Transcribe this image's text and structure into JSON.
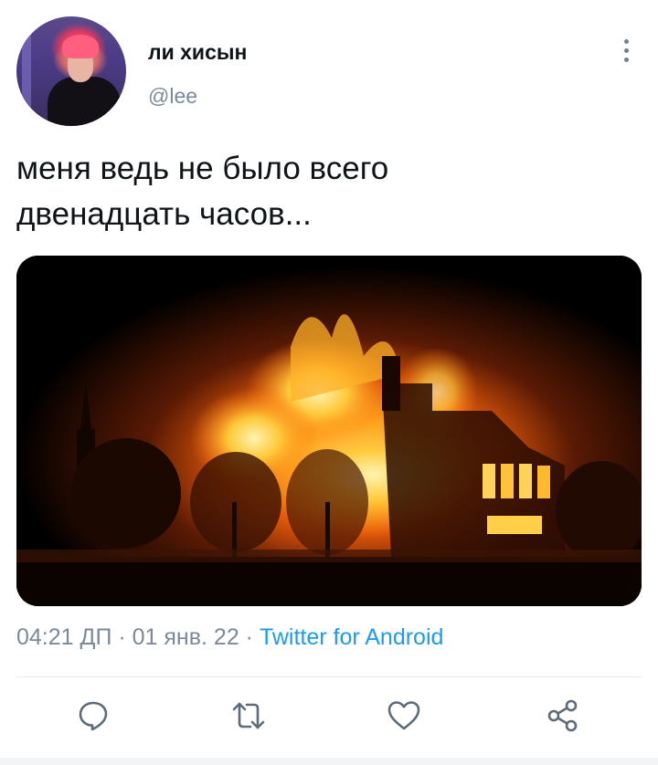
{
  "author": {
    "display_name": "ли хисын",
    "handle": "@lee"
  },
  "tweet": {
    "text": "меня ведь не было всего\nдвенадцать часов..."
  },
  "meta": {
    "time": "04:21 ДП",
    "separator": " · ",
    "date": "01 янв. 22",
    "source": "Twitter for Android"
  },
  "actions": {
    "reply": "reply-icon",
    "retweet": "retweet-icon",
    "like": "heart-icon",
    "share": "share-icon"
  },
  "colors": {
    "text": "#0f1419",
    "secondary": "#7b8a98",
    "accent": "#1d9bf0",
    "icon": "#5b6b7a"
  }
}
